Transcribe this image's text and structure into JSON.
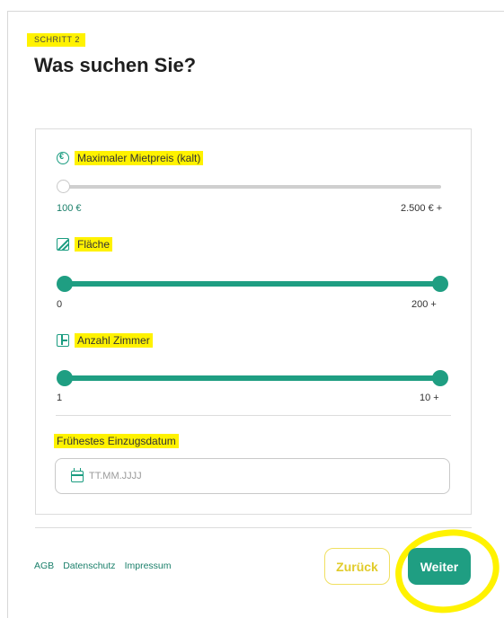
{
  "header": {
    "step_label": "SCHRITT 2",
    "title": "Was suchen Sie?"
  },
  "filters": {
    "rent": {
      "label": "Maximaler Mietpreis (kalt)",
      "min_label": "100 €",
      "max_label": "2.500 € +",
      "icon": "euro-icon",
      "value_fraction": 0
    },
    "area": {
      "label": "Fläche",
      "min_label": "0",
      "max_label": "200 +",
      "icon": "area-icon",
      "range": [
        0,
        1
      ]
    },
    "rooms": {
      "label": "Anzahl Zimmer",
      "min_label": "1",
      "max_label": "10 +",
      "icon": "rooms-icon",
      "range": [
        0,
        1
      ]
    },
    "move_in": {
      "label": "Frühestes Einzugsdatum",
      "placeholder": "TT.MM.JJJJ",
      "icon": "calendar-icon"
    }
  },
  "footer": {
    "links": [
      "AGB",
      "Datenschutz",
      "Impressum"
    ],
    "back_label": "Zurück",
    "next_label": "Weiter"
  },
  "colors": {
    "accent": "#1f9e82",
    "highlight": "#fff200",
    "back_button_text": "#e1cb2a"
  }
}
